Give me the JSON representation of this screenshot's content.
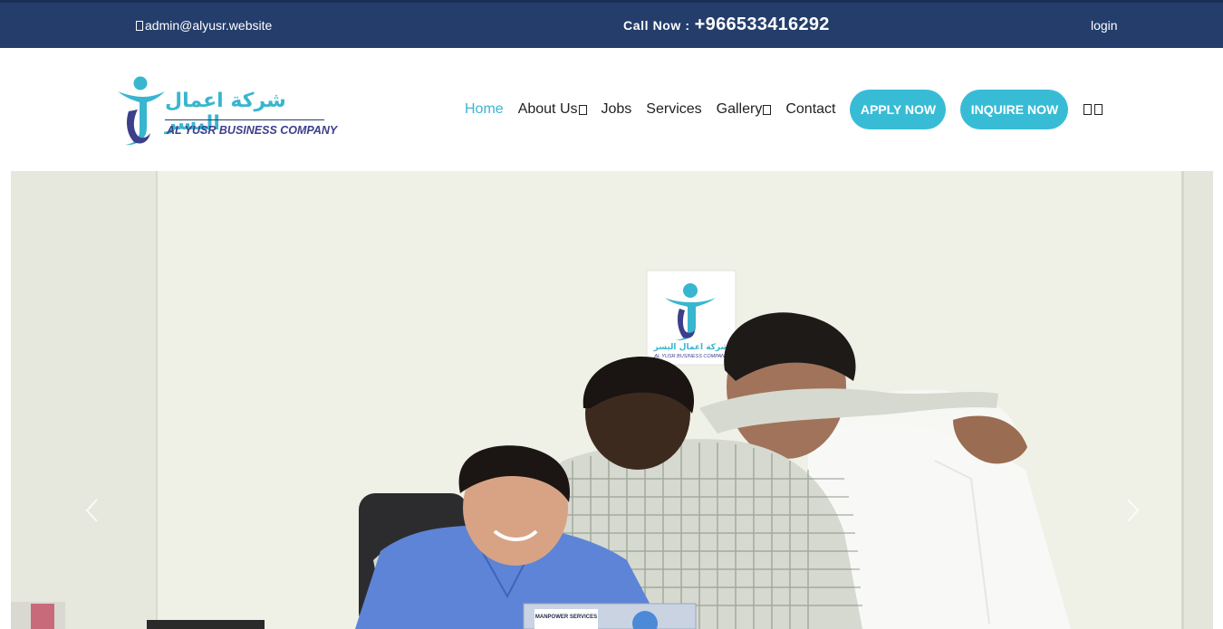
{
  "topbar": {
    "email": "admin@alyusr.website",
    "call_label": "Call Now :",
    "phone": "+966533416292",
    "login": "login"
  },
  "logo": {
    "arabic": "شركة اعمال اليسر",
    "english": "AL YUSR BUSINESS COMPANY",
    "colors": {
      "teal": "#38b6cf",
      "navy": "#3d3f8c"
    }
  },
  "nav": {
    "items": [
      {
        "label": "Home",
        "active": true
      },
      {
        "label": "About Us",
        "dropdown": true
      },
      {
        "label": "Jobs"
      },
      {
        "label": "Services"
      },
      {
        "label": "Gallery",
        "dropdown": true
      },
      {
        "label": "Contact"
      }
    ],
    "apply": "APPLY NOW",
    "inquire": "INQUIRE NOW",
    "icons": [
      "search-icon",
      "menu-icon"
    ]
  },
  "hero": {
    "poster": {
      "arabic": "شركة اعمال اليسر",
      "english": "AL YUSR BUSINESS COMPANY"
    },
    "sign": "MANPOWER SERVICES",
    "prev_icon": "chevron-left-icon",
    "next_icon": "chevron-right-icon"
  },
  "colors": {
    "topbar": "#243d6b",
    "accent": "#38bcd6",
    "text": "#222222"
  }
}
